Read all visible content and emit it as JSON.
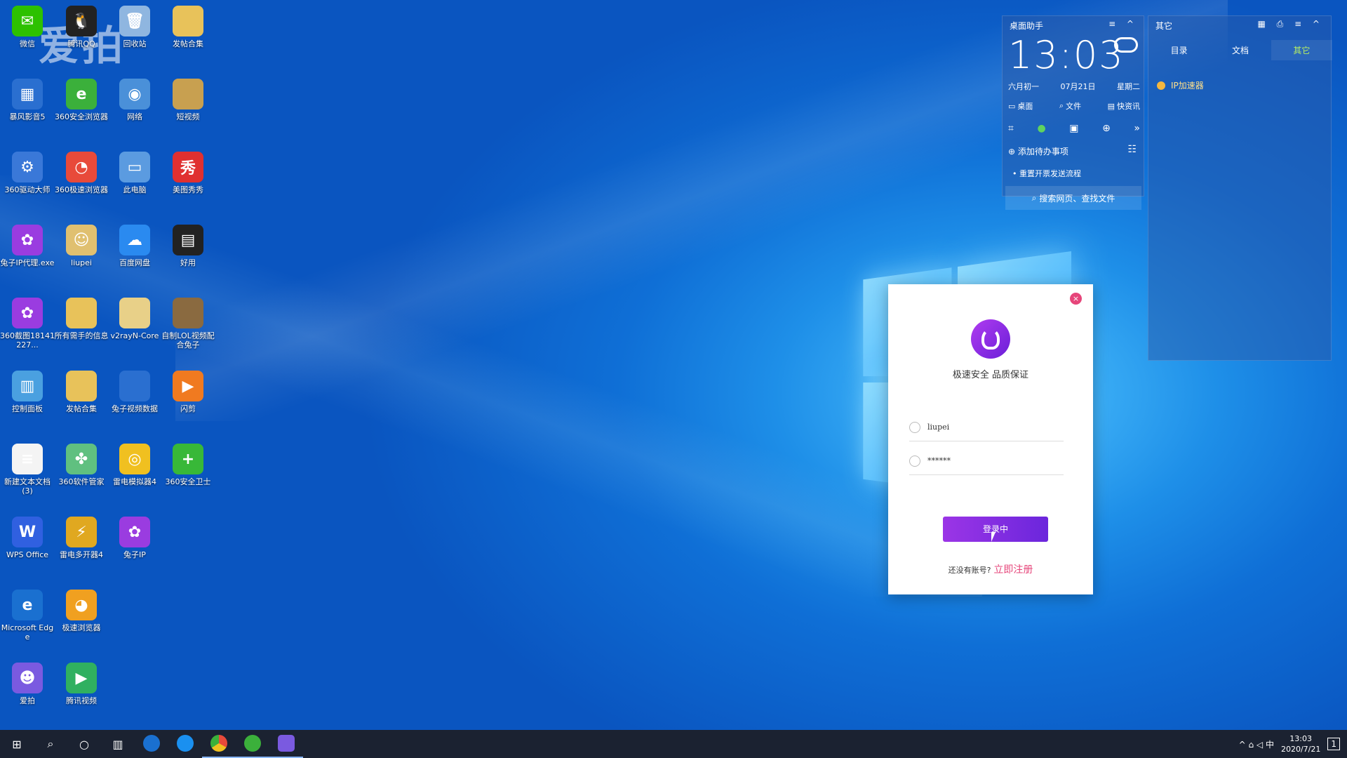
{
  "watermark": "爱拍",
  "desktop_icons": [
    {
      "label": "微信",
      "color": "#2dc100",
      "glyph": "✉"
    },
    {
      "label": "腾讯QQ",
      "color": "#222",
      "glyph": "🐧"
    },
    {
      "label": "回收站",
      "color": "#8fb6e0",
      "glyph": "🗑"
    },
    {
      "label": "发帖合集",
      "color": "#e8c25a",
      "glyph": ""
    },
    {
      "label": "暴风影音5",
      "color": "#2a6fd0",
      "glyph": "▦"
    },
    {
      "label": "360安全浏览器",
      "color": "#3bb03b",
      "glyph": "e"
    },
    {
      "label": "网络",
      "color": "#4a90d9",
      "glyph": "◉"
    },
    {
      "label": "短视频",
      "color": "#c8a050",
      "glyph": ""
    },
    {
      "label": "360驱动大师",
      "color": "#3a78d8",
      "glyph": "⚙"
    },
    {
      "label": "360极速浏览器",
      "color": "#e84a3a",
      "glyph": "◔"
    },
    {
      "label": "此电脑",
      "color": "#5b9be0",
      "glyph": "▭"
    },
    {
      "label": "美图秀秀",
      "color": "#e03030",
      "glyph": "秀"
    },
    {
      "label": "兔子IP代理.exe",
      "color": "#9a3ce0",
      "glyph": "✿"
    },
    {
      "label": "liupei",
      "color": "#e0c070",
      "glyph": "☺"
    },
    {
      "label": "百度网盘",
      "color": "#2a8af0",
      "glyph": "☁"
    },
    {
      "label": "好用",
      "color": "#222",
      "glyph": "▤"
    },
    {
      "label": "360截图18141227...",
      "color": "#9a3ce0",
      "glyph": "✿"
    },
    {
      "label": "所有需手的信息",
      "color": "#e8c25a",
      "glyph": ""
    },
    {
      "label": "v2rayN-Core",
      "color": "#e8d088",
      "glyph": ""
    },
    {
      "label": "自制LOL视频配合兔子",
      "color": "#8a6a40",
      "glyph": ""
    },
    {
      "label": "控制面板",
      "color": "#4aa0e0",
      "glyph": "▥"
    },
    {
      "label": "发帖合集",
      "color": "#e8c25a",
      "glyph": ""
    },
    {
      "label": "兔子视频数据",
      "color": "#2a6fd0",
      "glyph": ""
    },
    {
      "label": "闪剪",
      "color": "#f07a20",
      "glyph": "▶"
    },
    {
      "label": "新建文本文档(3)",
      "color": "#f4f4f4",
      "glyph": "≡"
    },
    {
      "label": "360软件管家",
      "color": "#60c080",
      "glyph": "✤"
    },
    {
      "label": "雷电模拟器4",
      "color": "#f0c020",
      "glyph": "◎"
    },
    {
      "label": "360安全卫士",
      "color": "#38b838",
      "glyph": "+"
    },
    {
      "label": "WPS Office",
      "color": "#3060e0",
      "glyph": "W"
    },
    {
      "label": "雷电多开器4",
      "color": "#e0a820",
      "glyph": "⚡"
    },
    {
      "label": "兔子IP",
      "color": "#9a3ce0",
      "glyph": "✿"
    },
    {
      "label": "Microsoft Edge",
      "color": "#1a70d0",
      "glyph": "e"
    },
    {
      "label": "极速浏览器",
      "color": "#f0a020",
      "glyph": "◕"
    },
    {
      "label": "爱拍",
      "color": "#7a5ae0",
      "glyph": "☻"
    },
    {
      "label": "腾讯视频",
      "color": "#30b060",
      "glyph": "▶"
    }
  ],
  "clock_widget": {
    "title": "桌面助手",
    "controls": "≡ ^",
    "time": "13:03",
    "lunar": "六月初一",
    "date": "07月21日",
    "weekday": "星期二",
    "row1": [
      "桌面",
      "文件",
      "快资讯"
    ],
    "row2": [
      "⌗",
      "●",
      "▣",
      "⊕",
      "»"
    ],
    "add_todo": "添加待办事项",
    "note": "重置开票发送流程",
    "search": "搜索网页、查找文件"
  },
  "other_widget": {
    "title": "其它",
    "controls": "▦ ⎙ ≡ ^",
    "tabs": [
      "目录",
      "文档",
      "其它"
    ],
    "item": "IP加速器"
  },
  "login": {
    "close": "×",
    "slogan": "极速安全 品质保证",
    "username": "liupei",
    "password": "******",
    "button": "登录中",
    "no_account": "还没有账号?",
    "register": "立即注册"
  },
  "taskbar": {
    "tray_icons": "^ ⌂ ◁ 中",
    "time": "13:03",
    "date": "2020/7/21",
    "notif": "1"
  }
}
